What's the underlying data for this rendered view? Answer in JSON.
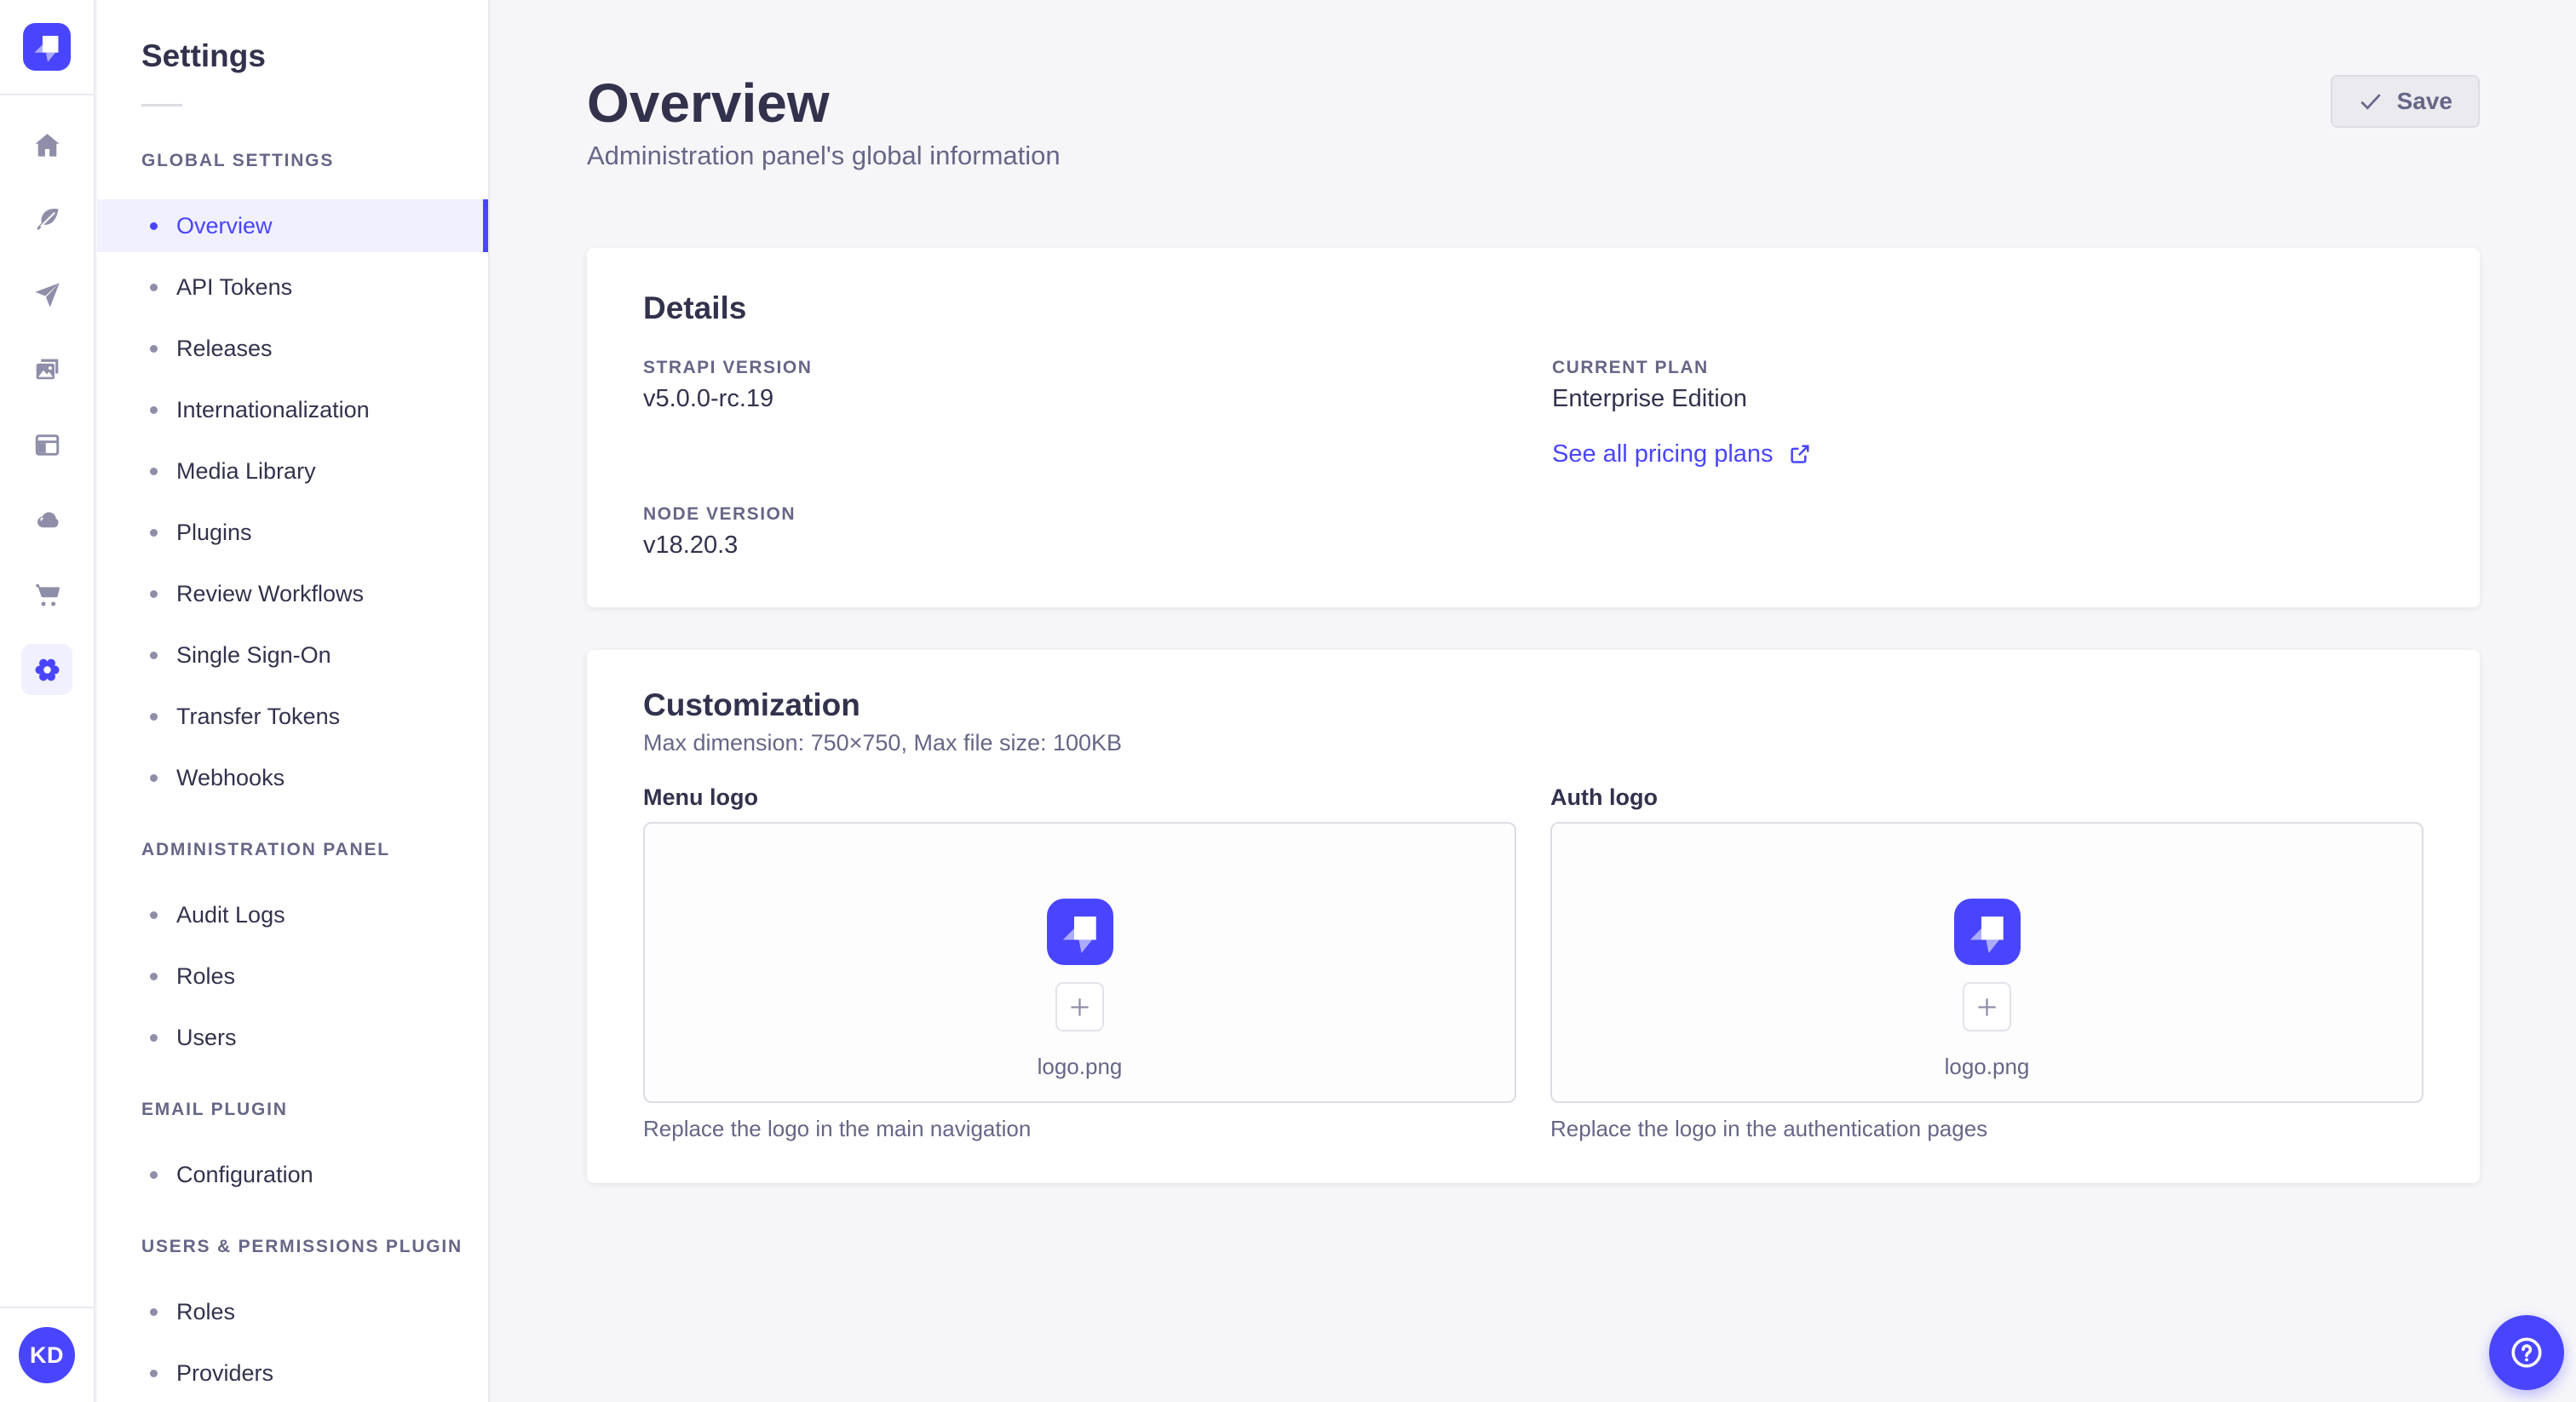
{
  "colors": {
    "primary": "#4945FF",
    "active_item_bg": "#F0F0FF",
    "page_bg": "#F6F6F9",
    "panel_bg": "#FFFFFF",
    "border": "#EAEAEF",
    "input_border": "#DCDCE4",
    "text_dark": "#32324D",
    "text_muted": "#666687",
    "icon_gray": "#8E8EA9"
  },
  "rail": {
    "logo_icon": "strapi-logo",
    "icons": [
      "home-icon",
      "feather-icon",
      "paper-plane-icon",
      "media-library-icon",
      "layout-icon",
      "cloud-icon",
      "marketplace-cart-icon",
      "settings-gear-icon"
    ],
    "active_icon": "settings-gear-icon",
    "avatar_initials": "KD"
  },
  "subnav": {
    "title": "Settings",
    "sections": [
      {
        "label": "GLOBAL SETTINGS",
        "items": [
          {
            "label": "Overview",
            "active": true
          },
          {
            "label": "API Tokens"
          },
          {
            "label": "Releases"
          },
          {
            "label": "Internationalization"
          },
          {
            "label": "Media Library"
          },
          {
            "label": "Plugins"
          },
          {
            "label": "Review Workflows"
          },
          {
            "label": "Single Sign-On"
          },
          {
            "label": "Transfer Tokens"
          },
          {
            "label": "Webhooks"
          }
        ]
      },
      {
        "label": "ADMINISTRATION PANEL",
        "items": [
          {
            "label": "Audit Logs"
          },
          {
            "label": "Roles"
          },
          {
            "label": "Users"
          }
        ]
      },
      {
        "label": "EMAIL PLUGIN",
        "items": [
          {
            "label": "Configuration"
          }
        ]
      },
      {
        "label": "USERS & PERMISSIONS PLUGIN",
        "items": [
          {
            "label": "Roles"
          },
          {
            "label": "Providers"
          }
        ]
      }
    ]
  },
  "main": {
    "header": {
      "title": "Overview",
      "subtitle": "Administration panel's global information",
      "save_button": {
        "label": "Save",
        "icon": "check-icon",
        "disabled": true
      }
    },
    "details": {
      "title": "Details",
      "fields": [
        {
          "label": "STRAPI VERSION",
          "value": "v5.0.0-rc.19"
        },
        {
          "label": "CURRENT PLAN",
          "value": "Enterprise Edition"
        },
        {
          "label": "NODE VERSION",
          "value": "v18.20.3"
        }
      ],
      "pricing_link": {
        "label": "See all pricing plans",
        "icon": "external-link-icon"
      }
    },
    "customization": {
      "title": "Customization",
      "subtitle": "Max dimension: 750×750, Max file size: 100KB",
      "uploads": [
        {
          "label": "Menu logo",
          "filename": "logo.png",
          "caption": "Replace the logo in the main navigation"
        },
        {
          "label": "Auth logo",
          "filename": "logo.png",
          "caption": "Replace the logo in the authentication pages"
        }
      ]
    }
  },
  "help_button": {
    "icon": "question-mark-icon"
  }
}
